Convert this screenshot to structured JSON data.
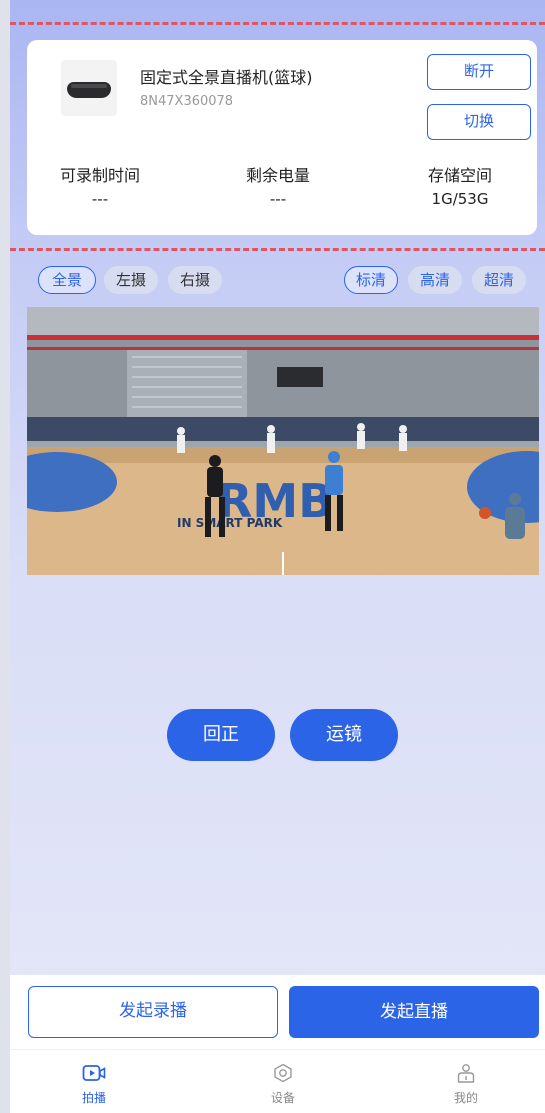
{
  "device": {
    "name": "固定式全景直播机(篮球)",
    "serial": "8N47X360078",
    "disconnect_label": "断开",
    "switch_label": "切换",
    "stats": [
      {
        "label": "可录制时间",
        "value": "---"
      },
      {
        "label": "剩余电量",
        "value": "---"
      },
      {
        "label": "存储空间",
        "value": "1G/53G"
      }
    ]
  },
  "view_tabs": [
    {
      "label": "全景",
      "active": true
    },
    {
      "label": "左摄",
      "active": false
    },
    {
      "label": "右摄",
      "active": false
    }
  ],
  "quality_tabs": [
    {
      "label": "标清",
      "active": true
    },
    {
      "label": "高清",
      "active": false
    },
    {
      "label": "超清",
      "active": false
    }
  ],
  "video": {
    "court_text_main": "RMB",
    "court_text_sub": "IN SMART PARK"
  },
  "controls": {
    "center_label": "回正",
    "motion_label": "运镜"
  },
  "actions": {
    "record_label": "发起录播",
    "live_label": "发起直播"
  },
  "nav": [
    {
      "label": "拍播",
      "icon": "camera-icon",
      "active": true
    },
    {
      "label": "设备",
      "icon": "gear-icon",
      "active": false
    },
    {
      "label": "我的",
      "icon": "user-icon",
      "active": false
    }
  ],
  "colors": {
    "accent": "#2c64e8",
    "dashed_border": "#e05563",
    "background_top": "#aab6f2",
    "background_bottom": "#e3e6f8"
  }
}
